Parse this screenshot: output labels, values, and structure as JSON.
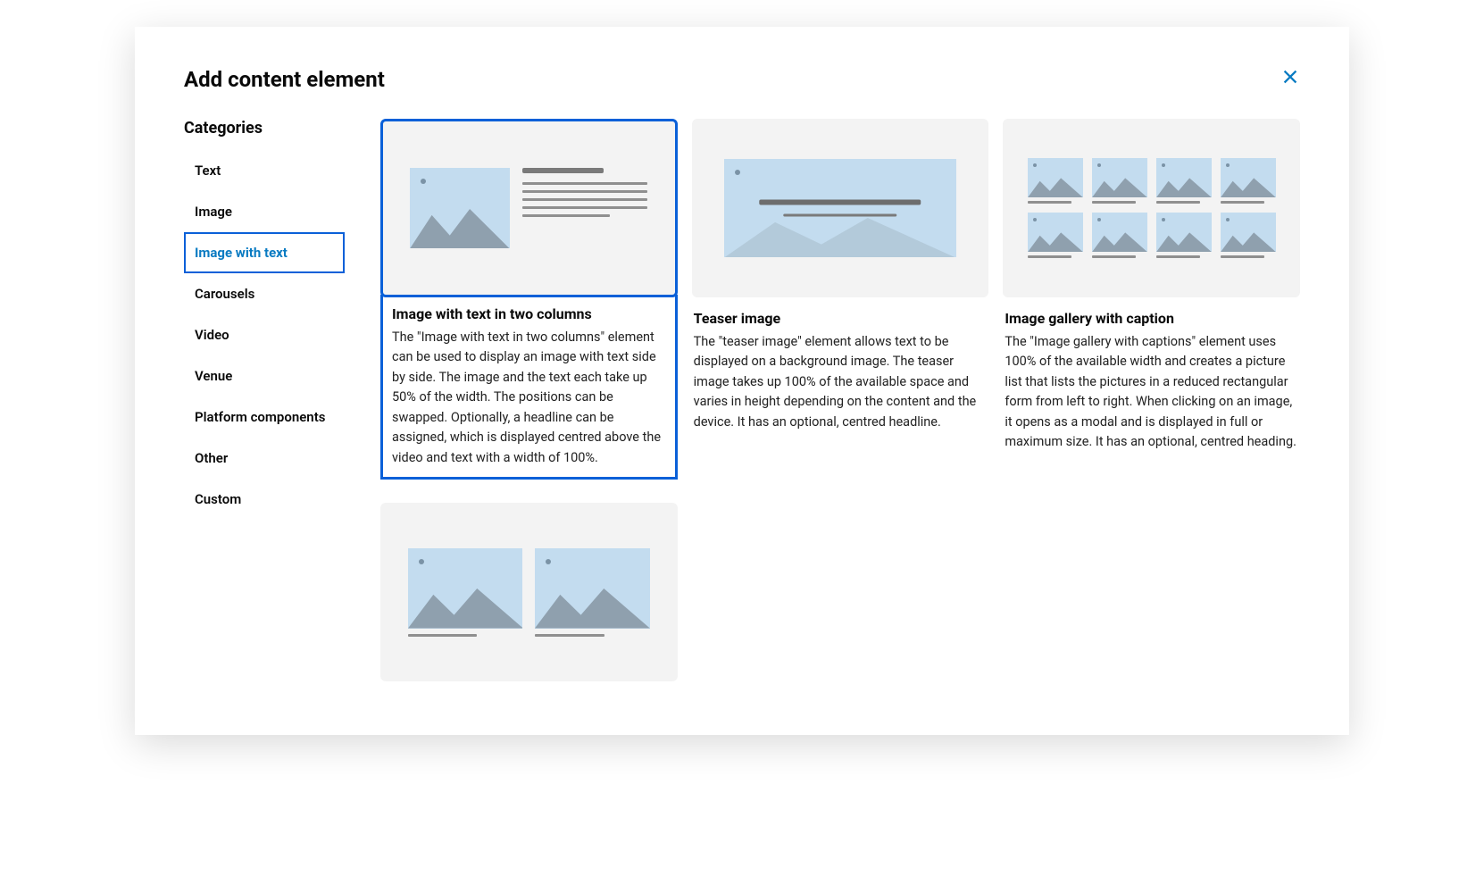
{
  "modal": {
    "title": "Add content element",
    "close_label": "Close"
  },
  "sidebar": {
    "heading": "Categories",
    "items": [
      {
        "label": "Text",
        "active": false
      },
      {
        "label": "Image",
        "active": false
      },
      {
        "label": "Image with text",
        "active": true
      },
      {
        "label": "Carousels",
        "active": false
      },
      {
        "label": "Video",
        "active": false
      },
      {
        "label": "Venue",
        "active": false
      },
      {
        "label": "Platform components",
        "active": false
      },
      {
        "label": "Other",
        "active": false
      },
      {
        "label": "Custom",
        "active": false
      }
    ]
  },
  "cards": [
    {
      "title": "Image with text in two columns",
      "description": "The \"Image with text in two columns\" element can be used to display an image with text side by side. The image and the text each take up 50% of the width. The positions can be swapped. Optionally, a headline can be assigned, which is displayed centred above the video and text with a width of 100%.",
      "selected": true,
      "preview": "two-col"
    },
    {
      "title": "Teaser image",
      "description": "The \"teaser image\" element allows text to be displayed on a background image. The teaser image takes up 100% of the available space and varies in height depending on the content and the device. It has an optional, centred headline.",
      "selected": false,
      "preview": "teaser"
    },
    {
      "title": "Image gallery with caption",
      "description": "The \"Image gallery with captions\" element uses 100% of the available width and creates a picture list that lists the pictures in a reduced rectangular form from left to right. When clicking on an image, it opens as a modal and is displayed in full or maximum size. It has an optional, centred heading.",
      "selected": false,
      "preview": "gallery"
    },
    {
      "title": "",
      "description": "",
      "selected": false,
      "preview": "two-side"
    }
  ]
}
